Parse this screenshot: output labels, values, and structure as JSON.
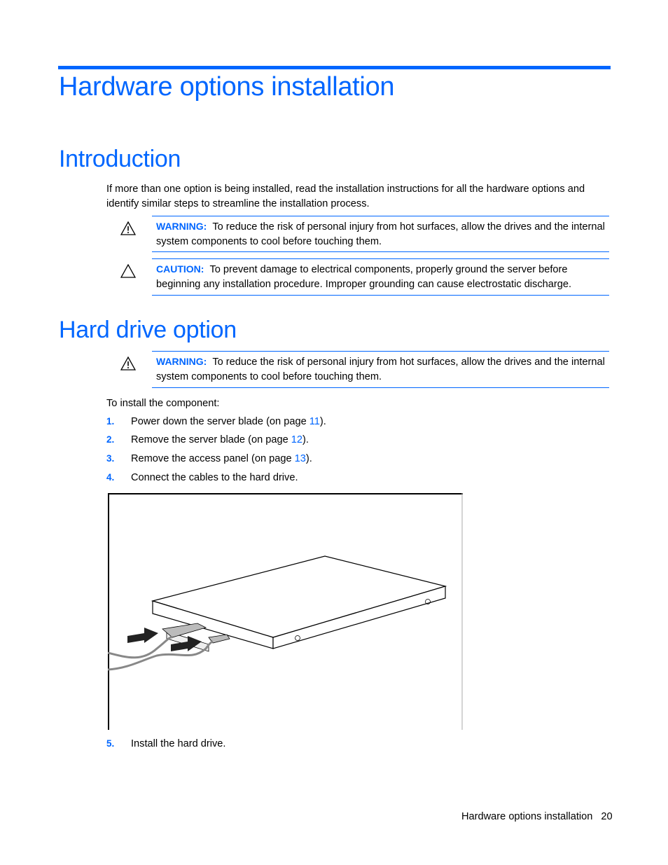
{
  "page": {
    "chapter_title": "Hardware options installation",
    "sections": {
      "introduction": {
        "heading": "Introduction",
        "paragraph": "If more than one option is being installed, read the installation instructions for all the hardware options and identify similar steps to streamline the installation process.",
        "warning": {
          "icon": "warning-triangle-exclamation-icon",
          "label": "WARNING:",
          "text": "To reduce the risk of personal injury from hot surfaces, allow the drives and the internal system components to cool before touching them."
        },
        "caution": {
          "icon": "caution-triangle-icon",
          "label": "CAUTION:",
          "text": "To prevent damage to electrical components, properly ground the server before beginning any installation procedure. Improper grounding can cause electrostatic discharge."
        }
      },
      "hard_drive": {
        "heading": "Hard drive option",
        "warning": {
          "icon": "warning-triangle-exclamation-icon",
          "label": "WARNING:",
          "text": "To reduce the risk of personal injury from hot surfaces, allow the drives and the internal system components to cool before touching them."
        },
        "intro": "To install the component:",
        "steps": [
          {
            "num": "1.",
            "text": "Power down the server blade (on page ",
            "link": "11",
            "after": ")."
          },
          {
            "num": "2.",
            "text": "Remove the server blade (on page ",
            "link": "12",
            "after": ")."
          },
          {
            "num": "3.",
            "text": "Remove the access panel (on page ",
            "link": "13",
            "after": ")."
          },
          {
            "num": "4.",
            "text": "Connect the cables to the hard drive.",
            "link": "",
            "after": ""
          },
          {
            "num": "5.",
            "text": "Install the hard drive.",
            "link": "",
            "after": ""
          }
        ],
        "figure": "hard-drive-cable-connection-illustration"
      }
    },
    "footer": {
      "section": "Hardware options installation",
      "page_number": "20"
    },
    "accent_color": "#0066ff"
  }
}
